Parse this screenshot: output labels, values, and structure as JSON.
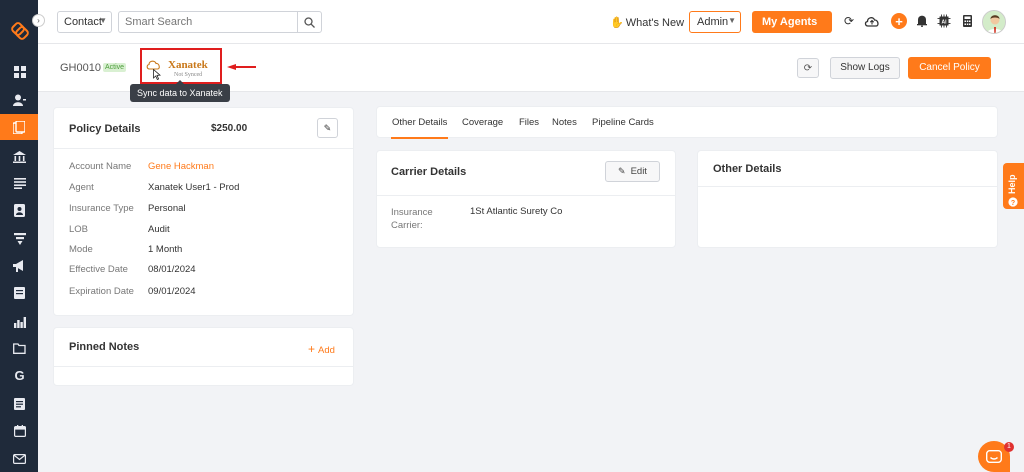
{
  "topbar": {
    "contact_select": "Contact",
    "search_placeholder": "Smart Search",
    "whats_new": "What's New",
    "admin_select": "Admin",
    "my_agents": "My Agents"
  },
  "header": {
    "policy_id": "GH0010",
    "status": "Active",
    "xanatek_name": "Xanatek",
    "xanatek_status": "Not Synced",
    "tooltip": "Sync data to Xanatek",
    "show_logs": "Show Logs",
    "cancel_policy": "Cancel Policy"
  },
  "policy": {
    "title": "Policy Details",
    "price": "$250.00",
    "fields": [
      {
        "label": "Account Name",
        "value": "Gene Hackman"
      },
      {
        "label": "Agent",
        "value": "Xanatek User1 - Prod"
      },
      {
        "label": "Insurance Type",
        "value": "Personal"
      },
      {
        "label": "LOB",
        "value": "Audit"
      },
      {
        "label": "Mode",
        "value": "1 Month"
      },
      {
        "label": "Effective Date",
        "value": "08/01/2024"
      },
      {
        "label": "Expiration Date",
        "value": "09/01/2024"
      }
    ]
  },
  "notes": {
    "title": "Pinned Notes",
    "add_label": "Add"
  },
  "tabs": [
    "Other Details",
    "Coverage",
    "Files",
    "Notes",
    "Pipeline Cards"
  ],
  "carrier": {
    "title": "Carrier Details",
    "edit_label": "Edit",
    "field_label": "Insurance Carrier:",
    "field_value": "1St Atlantic Surety Co"
  },
  "other": {
    "title": "Other Details"
  },
  "help": {
    "label": "Help",
    "chat_badge": "1"
  },
  "colors": {
    "accent": "#ff7a1a",
    "sidebar": "#1f2a3a"
  },
  "sidebar_icons": [
    "dashboard-icon",
    "contacts-icon",
    "policies-icon",
    "carriers-icon",
    "list-icon",
    "contact-card-icon",
    "filter-icon",
    "campaigns-icon",
    "documents-icon",
    "reports-icon",
    "folder-icon",
    "google-icon",
    "forms-icon",
    "calendar-icon",
    "mail-icon"
  ]
}
